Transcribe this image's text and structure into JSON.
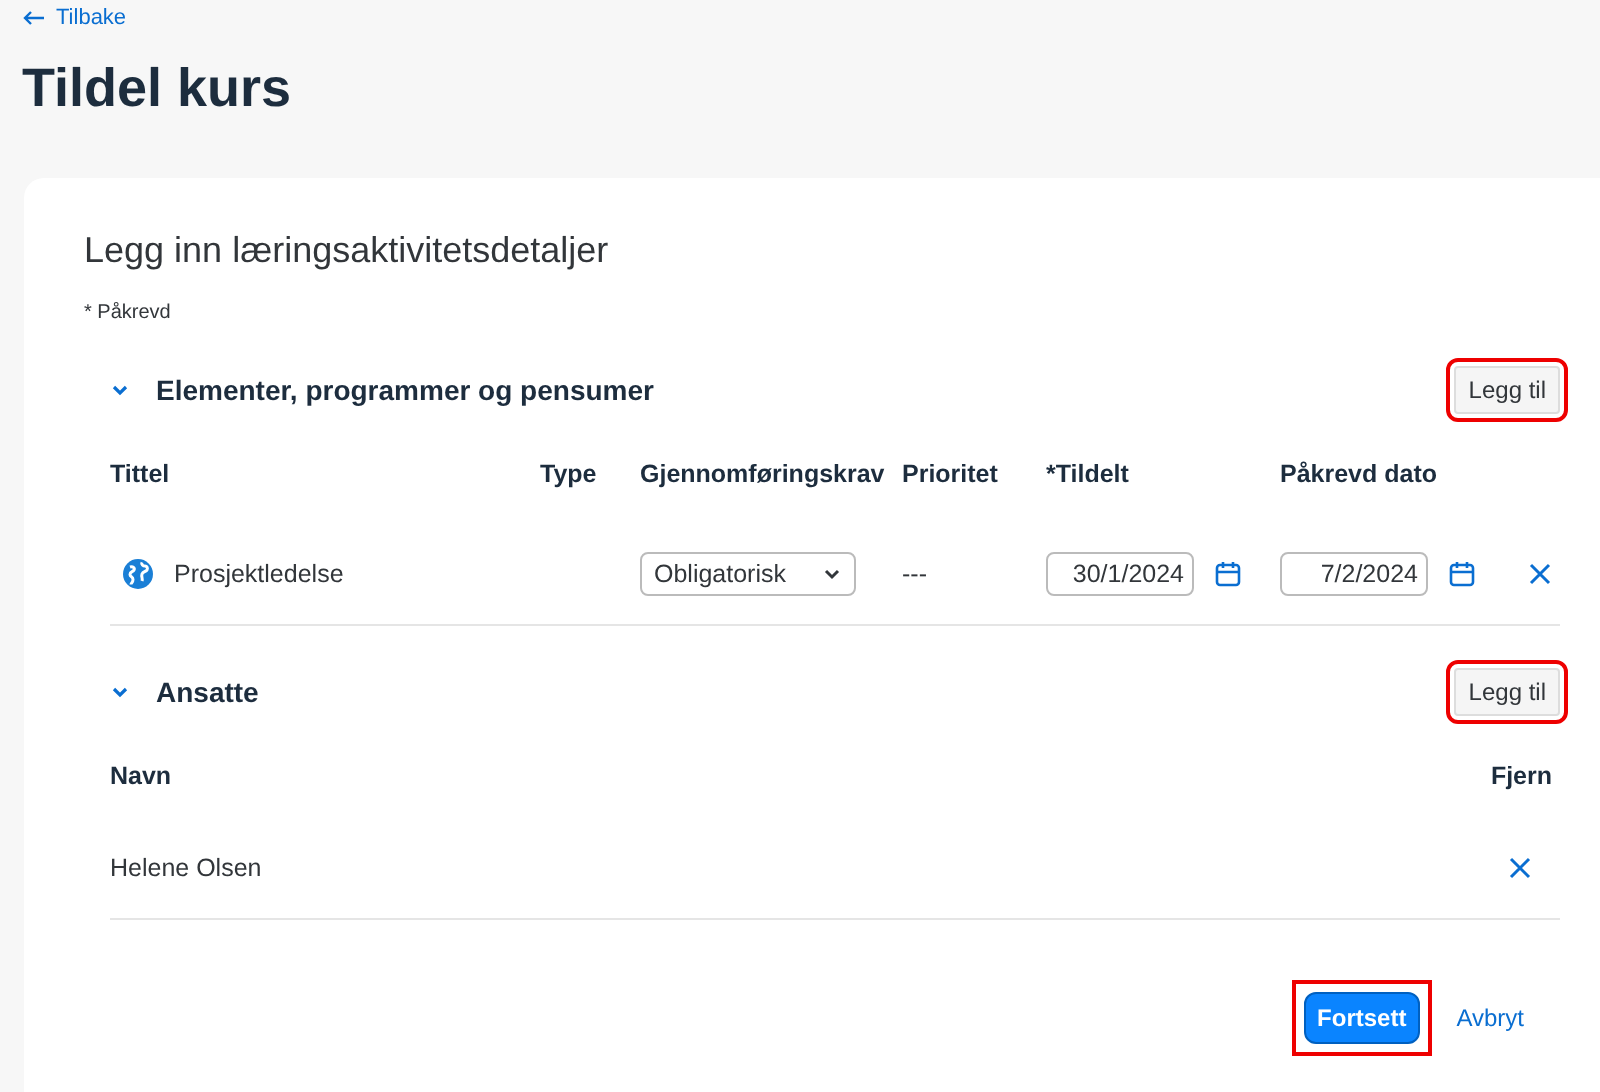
{
  "back_link": "Tilbake",
  "title": "Tildel kurs",
  "card": {
    "heading": "Legg inn læringsaktivitetsdetaljer",
    "required_note": "* Påkrevd",
    "sections": [
      {
        "kind": "items",
        "title": "Elementer, programmer og pensumer",
        "expanded": true,
        "add_button": {
          "label": "Legg til",
          "highlighted": true
        },
        "columns": [
          "Tittel",
          "Type",
          "Gjennomføringskrav",
          "Prioritet",
          "*Tildelt",
          "Påkrevd dato"
        ],
        "rows": [
          {
            "title": "Prosjektledelse",
            "requirement": "Obligatorisk",
            "priority": "---",
            "assigned": "30/1/2024",
            "due": "7/2/2024"
          }
        ]
      },
      {
        "kind": "people",
        "title": "Ansatte",
        "expanded": true,
        "add_button": {
          "label": "Legg til",
          "highlighted": true
        },
        "columns": [
          "Navn",
          "Fjern"
        ],
        "rows": [
          {
            "name": "Helene Olsen"
          }
        ]
      }
    ]
  },
  "actions": [
    {
      "kind": "primary",
      "label": "Fortsett",
      "highlighted": true
    },
    {
      "kind": "link",
      "label": "Avbryt",
      "highlighted": false
    }
  ]
}
